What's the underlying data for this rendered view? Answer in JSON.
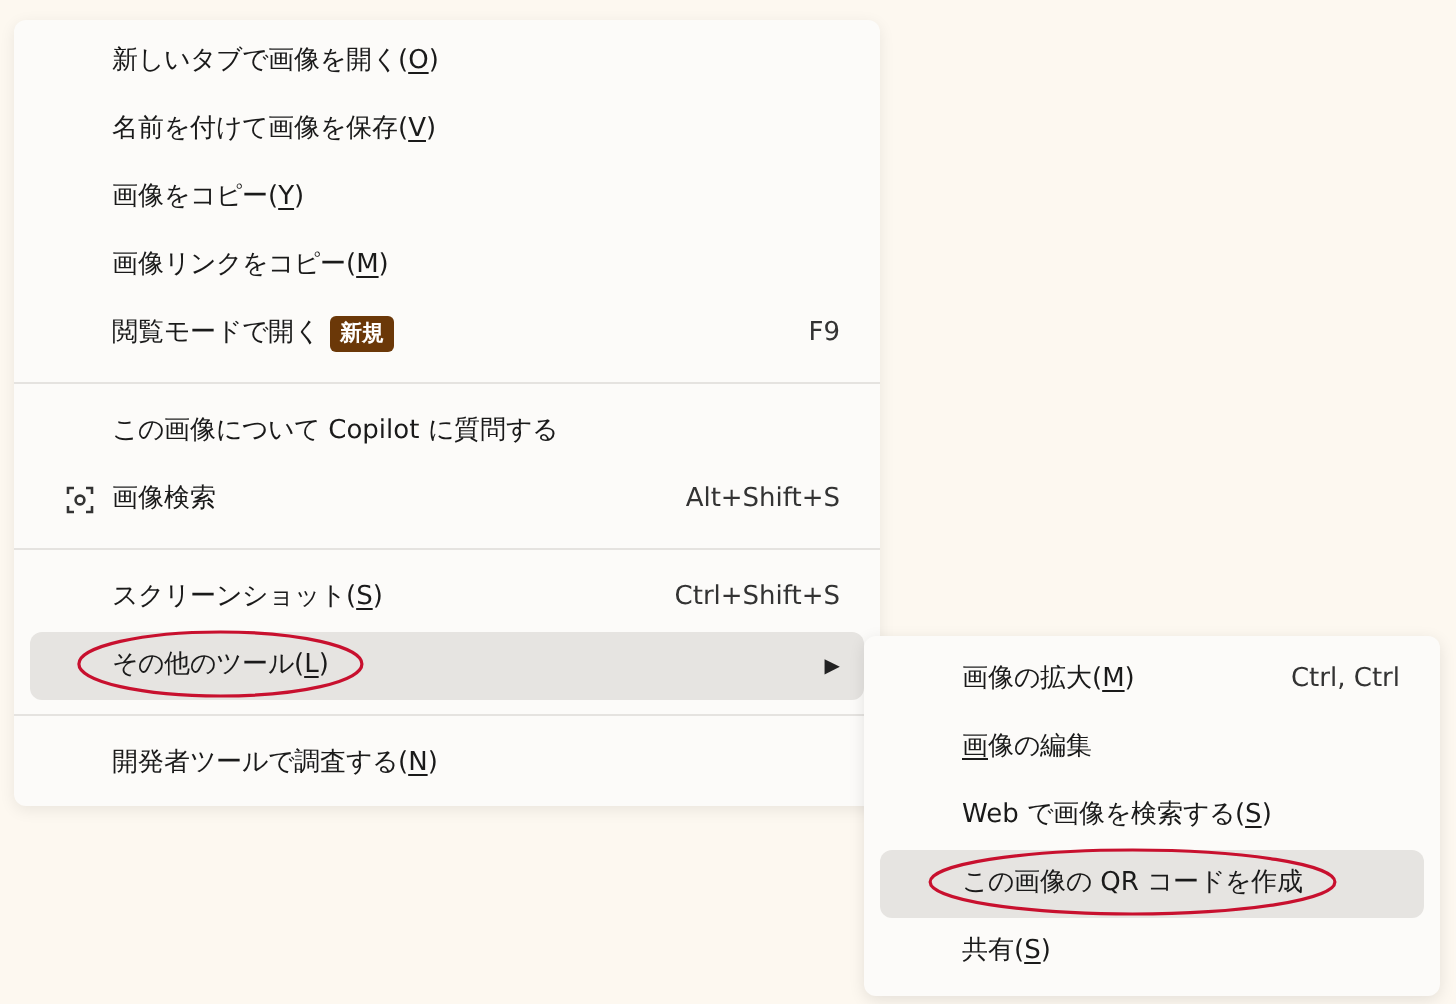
{
  "context_menu": {
    "items": [
      {
        "kind": "item",
        "label": "新しいタブで画像を開く(",
        "access_key": "O",
        "label_end": ")",
        "selected": false,
        "annotated": false
      },
      {
        "kind": "item",
        "label": "名前を付けて画像を保存(",
        "access_key": "V",
        "label_end": ")",
        "selected": false,
        "annotated": false
      },
      {
        "kind": "item",
        "label": "画像をコピー(",
        "access_key": "Y",
        "label_end": ")",
        "selected": false,
        "annotated": false
      },
      {
        "kind": "item",
        "label": "画像リンクをコピー(",
        "access_key": "M",
        "label_end": ")",
        "selected": false,
        "annotated": false
      },
      {
        "kind": "item",
        "label": "閲覧モードで開く",
        "badge": "新規",
        "shortcut": "F9",
        "selected": false,
        "annotated": false
      },
      {
        "kind": "separator"
      },
      {
        "kind": "item",
        "label": "この画像について Copilot に質問する",
        "selected": false,
        "annotated": false
      },
      {
        "kind": "icon_item",
        "label": "画像検索",
        "shortcut": "Alt+Shift+S",
        "selected": false,
        "annotated": false
      },
      {
        "kind": "separator"
      },
      {
        "kind": "item",
        "label": "スクリーンショット(",
        "access_key": "S",
        "label_end": ")",
        "shortcut": "Ctrl+Shift+S",
        "selected": false,
        "annotated": false
      },
      {
        "kind": "item",
        "label": "その他のツール(",
        "access_key": "L",
        "label_end": ")",
        "submenu_arrow": "▶",
        "selected": true,
        "annotated": true
      },
      {
        "kind": "separator"
      },
      {
        "kind": "item",
        "label": "開発者ツールで調査する(",
        "access_key": "N",
        "label_end": ")",
        "selected": false,
        "annotated": false
      }
    ]
  },
  "submenu": {
    "items": [
      {
        "kind": "item",
        "label": "画像の拡大(",
        "access_key": "M",
        "label_end": ")",
        "shortcut": "Ctrl, Ctrl",
        "selected": false,
        "annotated": false
      },
      {
        "kind": "item",
        "access_key": "画",
        "label_end": "像の編集",
        "selected": false,
        "annotated": false
      },
      {
        "kind": "item",
        "label": "Web で画像を検索する(",
        "access_key": "S",
        "label_end": ")",
        "selected": false,
        "annotated": false
      },
      {
        "kind": "item",
        "label": "この画像の QR コードを作成",
        "selected": true,
        "annotated": true
      },
      {
        "kind": "item",
        "label": "共有(",
        "access_key": "S",
        "label_end": ")",
        "selected": false,
        "annotated": false
      }
    ]
  }
}
